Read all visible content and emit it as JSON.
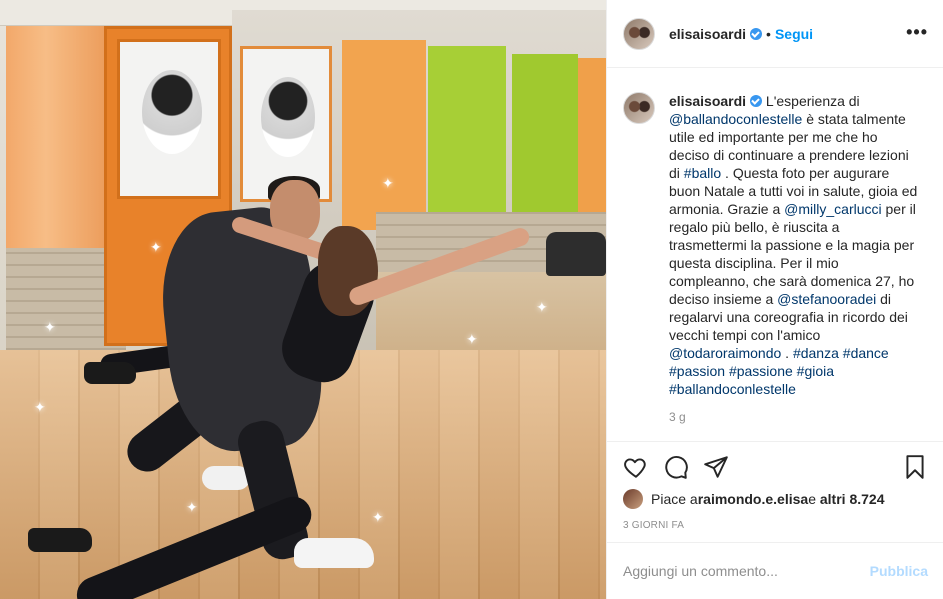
{
  "post": {
    "image_alt": "photo",
    "header": {
      "username": "elisaisoardi",
      "separator": "•",
      "follow_label": "Segui",
      "more_label": "•••"
    },
    "caption": {
      "username": "elisaisoardi",
      "t1": " L'esperienza di ",
      "m1": "@ballandoconlestelle",
      "t2": " è stata talmente utile ed importante per me che ho deciso di continuare a prendere lezioni di ",
      "h1": "#ballo",
      "t3": " . Questa foto per augurare buon Natale a tutti voi in salute, gioia ed armonia. Grazie a ",
      "m2": "@milly_carlucci",
      "t4": " per il regalo più bello, è riuscita a trasmettermi la passione e la magia per questa disciplina. Per il mio compleanno, che sarà domenica 27, ho deciso insieme a ",
      "m3": "@stefanooradei",
      "t5": " di regalarvi una coreografia in ricordo dei vecchi tempi con l'amico ",
      "m4": "@todaroraimondo",
      "t6": " . ",
      "tags": [
        "#danza",
        "#dance",
        "#passion",
        "#passione",
        "#gioia",
        "#ballandoconlestelle"
      ],
      "age": "3 g"
    },
    "likes": {
      "prefix": "Piace a ",
      "user": "raimondo.e.elisa",
      "middle": " e ",
      "others": "altri 8.724"
    },
    "timestamp": "3 GIORNI FA",
    "comment": {
      "placeholder": "Aggiungi un commento...",
      "publish_label": "Pubblica"
    },
    "icons": {
      "like": "heart-icon",
      "comment": "comment-icon",
      "share": "share-icon",
      "save": "bookmark-icon"
    },
    "colors": {
      "accent": "#0095f6",
      "tag": "#00376b",
      "publish_disabled": "#b3dbff",
      "verified": "#3897f0"
    }
  }
}
